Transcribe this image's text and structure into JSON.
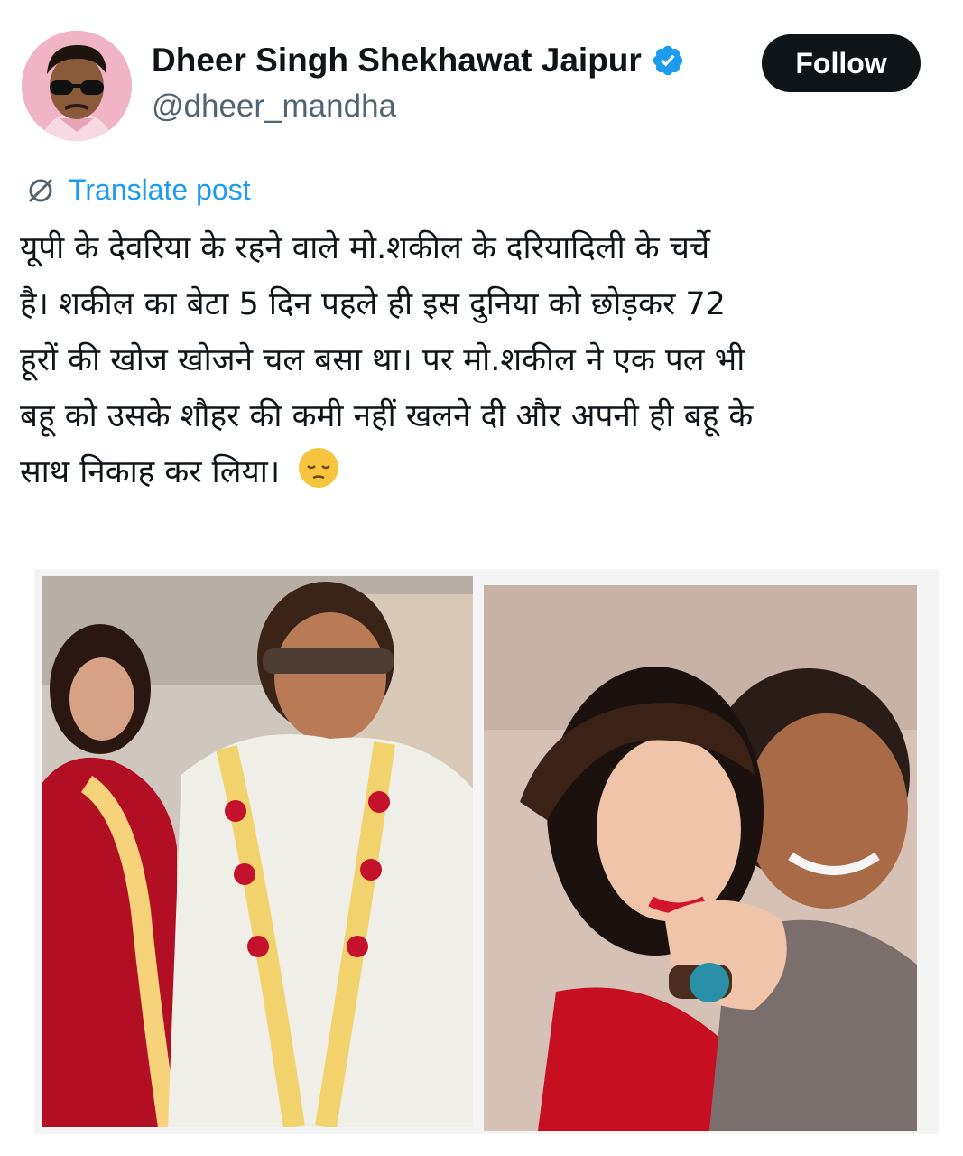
{
  "author": {
    "display_name": "Dheer Singh Shekhawat Jaipur",
    "handle": "@dheer_mandha",
    "verified_icon": "verified-badge-icon"
  },
  "actions": {
    "follow_label": "Follow",
    "translate_label": "Translate post",
    "translate_icon": "translate-globe-icon"
  },
  "post": {
    "lines": [
      "यूपी के देवरिया के रहने वाले मो.शकील के दरियादिली के चर्चे",
      "है। शकील का बेटा 5 दिन पहले ही इस दुनिया को छोड़कर 72",
      "हूरों की खोज खोजने चल बसा था। पर मो.शकील ने एक पल भी",
      "बहू को उसके शौहर की कमी नहीं खलने दी और अपनी ही बहू के",
      "साथ निकाह कर लिया।"
    ],
    "emoji": "pensive-face-emoji"
  },
  "colors": {
    "accent": "#1d9bf0",
    "text": "#0f1419",
    "secondary": "#536471",
    "button_bg": "#0f1419"
  }
}
